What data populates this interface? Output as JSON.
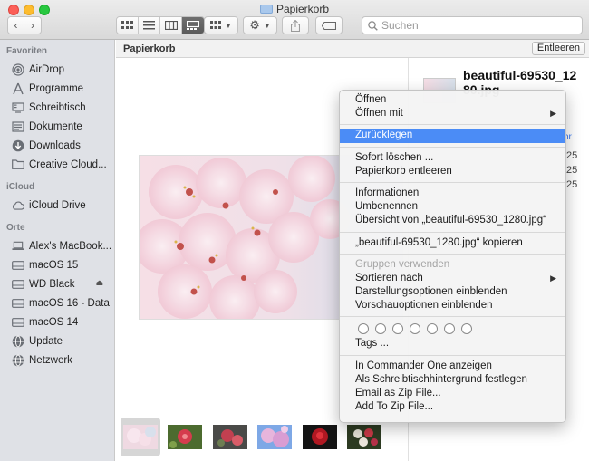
{
  "window": {
    "title": "Papierkorb"
  },
  "toolbar": {
    "back_icon": "chevron-left-icon",
    "forward_icon": "chevron-right-icon",
    "view_modes": [
      "icon-view-icon",
      "list-view-icon",
      "column-view-icon",
      "gallery-view-icon"
    ],
    "group_icon": "group-grid-icon",
    "action_icon": "gear-icon",
    "share_icon": "share-icon",
    "tag_icon": "tag-icon",
    "search_placeholder": "Suchen"
  },
  "sidebar": {
    "sections": [
      {
        "title": "Favoriten",
        "items": [
          {
            "label": "AirDrop",
            "icon": "airdrop-icon"
          },
          {
            "label": "Programme",
            "icon": "applications-icon"
          },
          {
            "label": "Schreibtisch",
            "icon": "desktop-icon"
          },
          {
            "label": "Dokumente",
            "icon": "document-icon"
          },
          {
            "label": "Downloads",
            "icon": "download-icon"
          },
          {
            "label": "Creative Cloud...",
            "icon": "folder-icon"
          }
        ]
      },
      {
        "title": "iCloud",
        "items": [
          {
            "label": "iCloud Drive",
            "icon": "cloud-icon"
          }
        ]
      },
      {
        "title": "Orte",
        "items": [
          {
            "label": "Alex's MacBook...",
            "icon": "laptop-icon"
          },
          {
            "label": "macOS 15",
            "icon": "disk-icon"
          },
          {
            "label": "WD Black",
            "icon": "disk-icon",
            "eject": true
          },
          {
            "label": "macOS 16 - Data",
            "icon": "disk-icon"
          },
          {
            "label": "macOS 14",
            "icon": "disk-icon"
          },
          {
            "label": "Update",
            "icon": "globe-icon"
          },
          {
            "label": "Netzwerk",
            "icon": "network-icon"
          }
        ]
      }
    ]
  },
  "main": {
    "path": "Papierkorb",
    "empty_button": "Entleeren",
    "info": {
      "filename": "beautiful-69530_1280.jpg",
      "more_link": "hr",
      "values": [
        "25",
        "25",
        "25"
      ]
    }
  },
  "context_menu": {
    "groups": [
      [
        {
          "label": "Öffnen"
        },
        {
          "label": "Öffnen mit",
          "submenu": true
        }
      ],
      [
        {
          "label": "Zurücklegen",
          "highlighted": true
        }
      ],
      [
        {
          "label": "Sofort löschen ..."
        },
        {
          "label": "Papierkorb entleeren"
        }
      ],
      [
        {
          "label": "Informationen"
        },
        {
          "label": "Umbenennen"
        },
        {
          "label": "Übersicht von „beautiful-69530_1280.jpg“"
        }
      ],
      [
        {
          "label": "„beautiful-69530_1280.jpg“ kopieren"
        }
      ],
      [
        {
          "label": "Gruppen verwenden",
          "disabled": true
        },
        {
          "label": "Sortieren nach",
          "submenu": true
        },
        {
          "label": "Darstellungsoptionen einblenden"
        },
        {
          "label": "Vorschauoptionen einblenden"
        }
      ],
      [
        {
          "tags": 7
        },
        {
          "label": "Tags ..."
        }
      ],
      [
        {
          "label": "In Commander One anzeigen"
        },
        {
          "label": "Als Schreibtischhintergrund festlegen"
        },
        {
          "label": "Email as Zip File..."
        },
        {
          "label": "Add To Zip File..."
        }
      ]
    ]
  },
  "colors": {
    "highlight": "#4b8cf6",
    "sidebar_bg": "#dfe1e6"
  }
}
